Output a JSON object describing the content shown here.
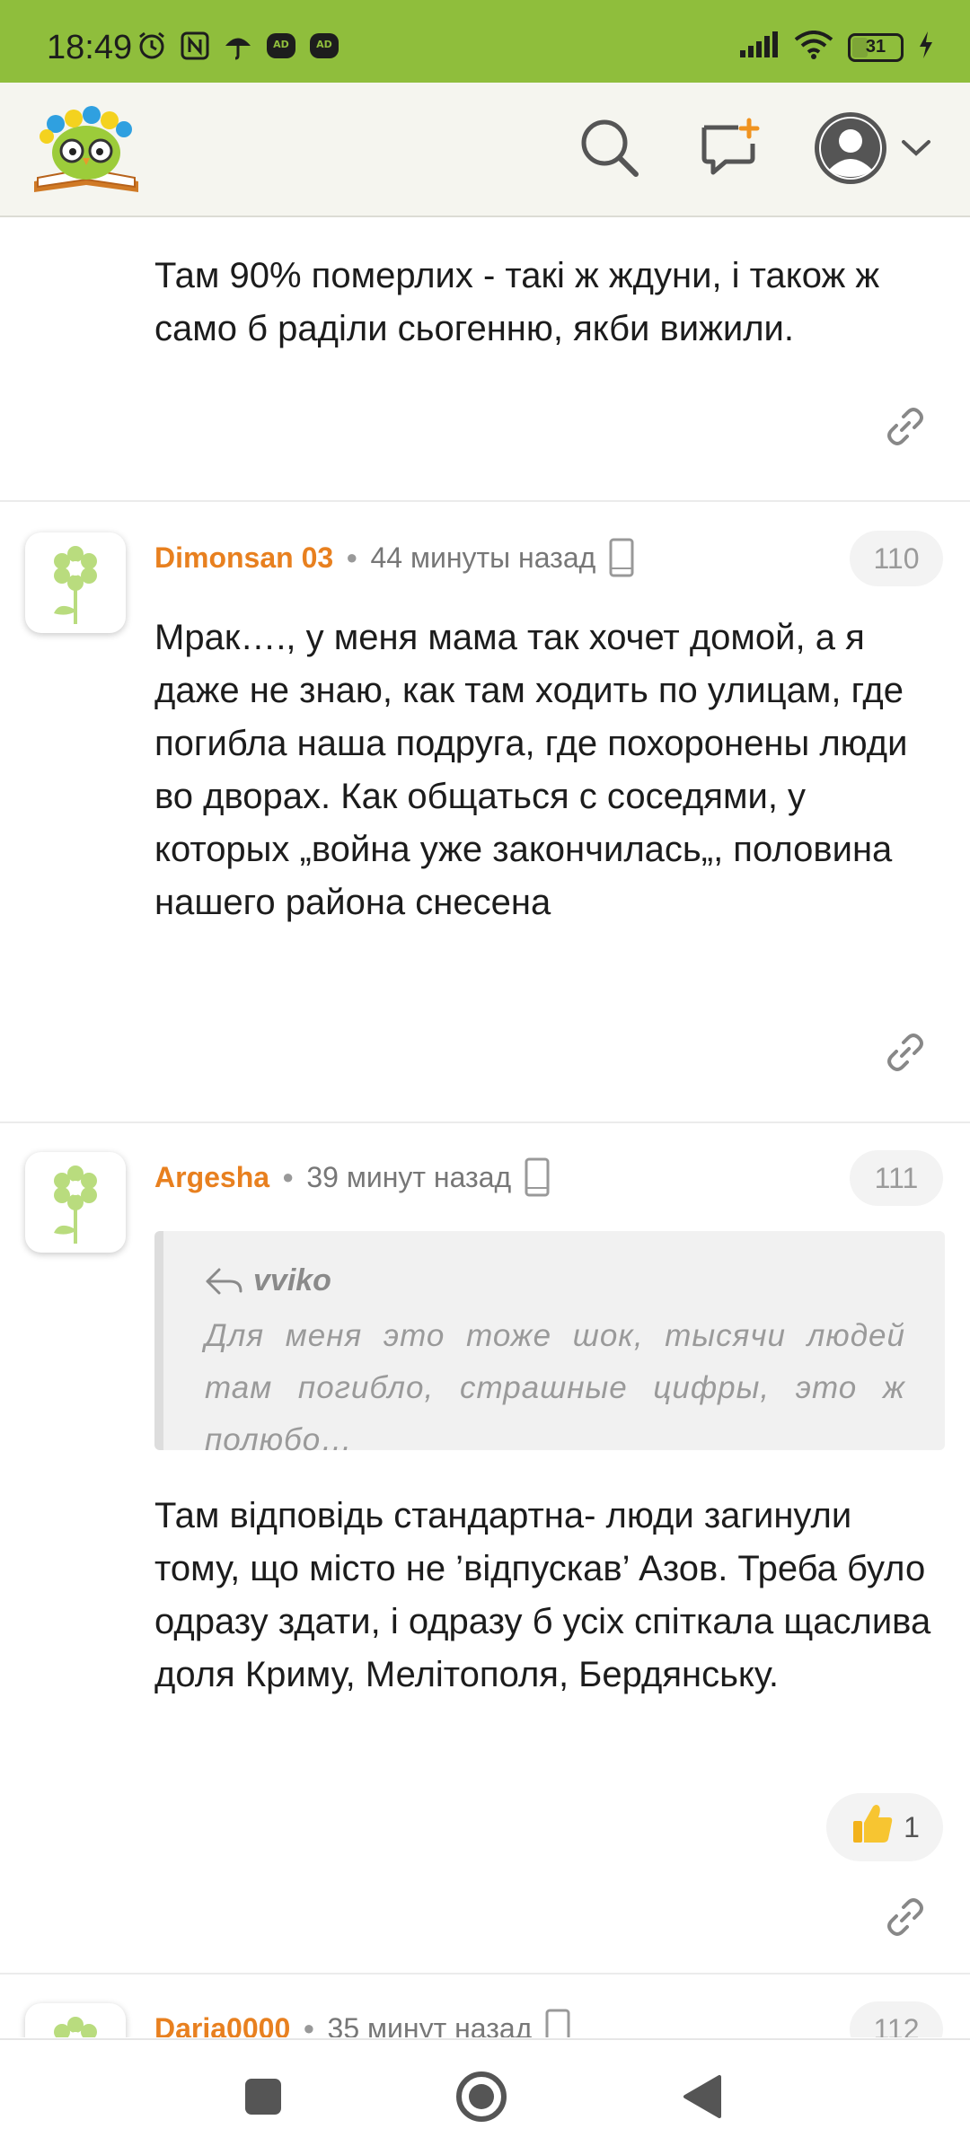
{
  "status_bar": {
    "time": "18:49",
    "battery": "31",
    "icons": [
      "alarm-icon",
      "nfc-icon",
      "umbrella-icon",
      "adblock-icon",
      "adblock-icon",
      "signal-icon",
      "wifi-icon",
      "battery-icon",
      "charging-icon"
    ]
  },
  "header": {
    "logo": "owl-book-logo",
    "icons": [
      "search-icon",
      "compose-icon",
      "user-avatar-icon",
      "chevron-down-icon"
    ]
  },
  "comments": [
    {
      "text": "Там 90% померлих - такі ж ждуни, і також ж само б раділи сьогенню, якби вижили."
    },
    {
      "author": "Dimonsan 03",
      "time": "44 минуты назад",
      "number": "110",
      "text": "Мрак…., у меня мама так хочет домой, а я даже не знаю, как там ходить по улицам, где погибла наша подруга, где похоронены люди во дворах. Как общаться с соседями, у которых „война уже закончилась„, половина нашего района снесена"
    },
    {
      "author": "Argesha",
      "time": "39 минут назад",
      "number": "111",
      "quote_author": "vviko",
      "quote_text": "Для меня это тоже шок, тысячи людей там погибло, страшные цифры, это ж полюбо…",
      "text": "Там відповідь стандартна- люди загинули тому, що місто не ’відпускав’ Азов. Треба було одразу здати, і одразу б усіх спіткала щаслива доля Криму, Мелітополя, Бердянську.",
      "likes": "1"
    },
    {
      "author": "Daria0000",
      "time": "35 минут назад",
      "number": "112"
    }
  ],
  "colors": {
    "status_bar": "#8fbe3c",
    "author": "#e8801f",
    "header_bg": "#f5f5ef"
  }
}
